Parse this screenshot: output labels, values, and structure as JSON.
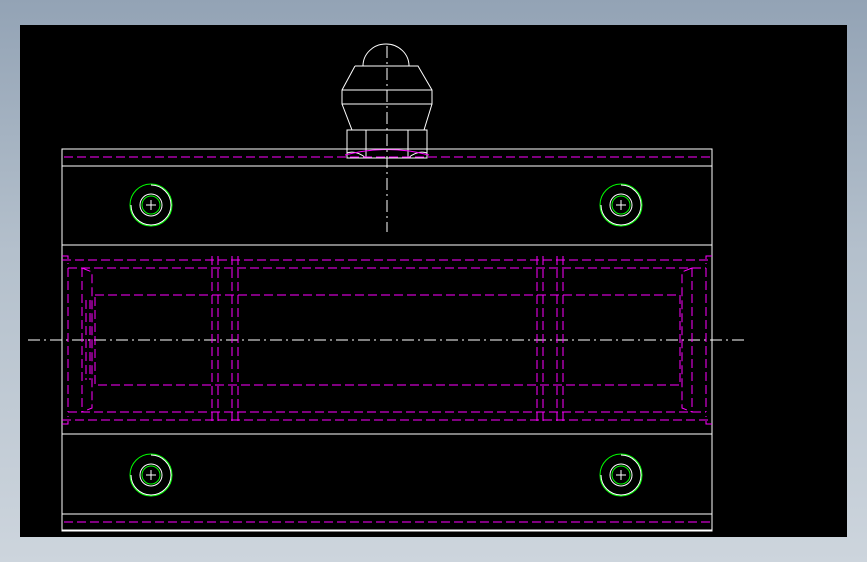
{
  "drawing": {
    "colors": {
      "background": "#000000",
      "outline": "#ffffff",
      "hidden": "#ff00ff",
      "hole": "#00ff00"
    },
    "icons": [
      "grease-nipple-icon",
      "mounting-hole-icon",
      "crosshair-icon"
    ]
  }
}
